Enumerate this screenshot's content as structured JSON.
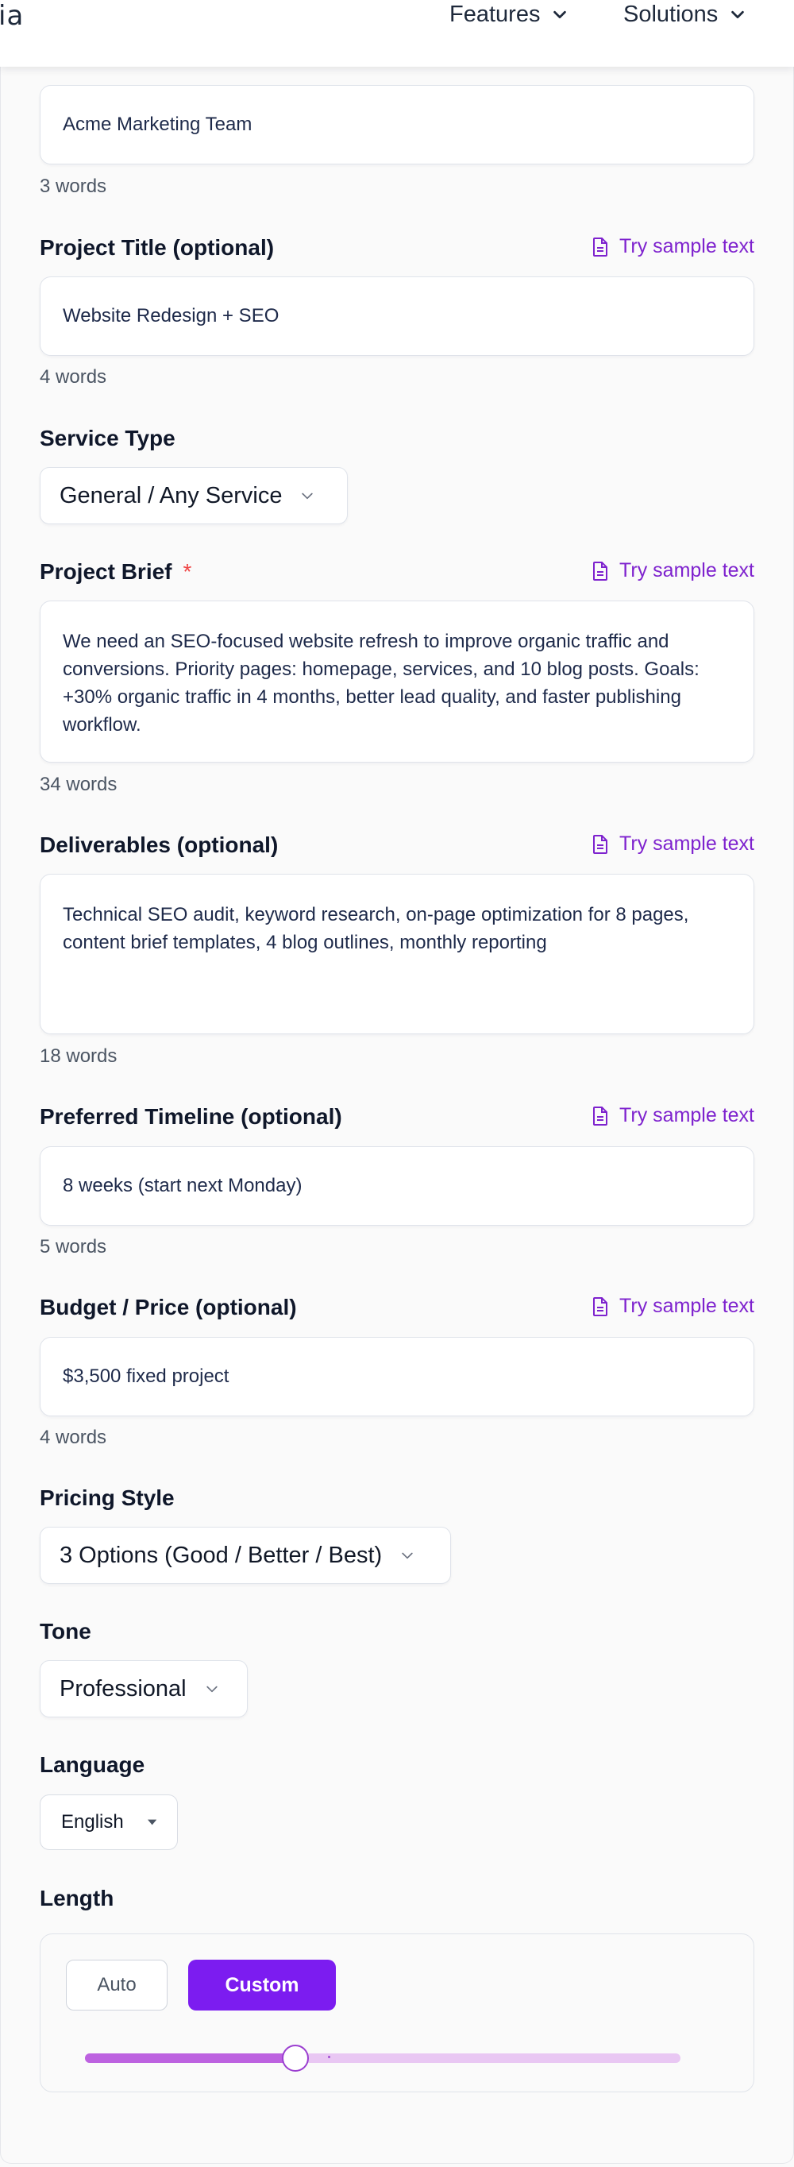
{
  "header": {
    "logo_fragment": "ia",
    "nav": [
      {
        "label": "Features"
      },
      {
        "label": "Solutions"
      }
    ]
  },
  "form": {
    "sample_link": "Try sample text",
    "client": {
      "value": "Acme Marketing Team",
      "count": "3 words"
    },
    "project_title": {
      "label": "Project Title (optional)",
      "value": "Website Redesign + SEO",
      "count": "4 words"
    },
    "service_type": {
      "label": "Service Type",
      "value": "General / Any Service"
    },
    "project_brief": {
      "label": "Project Brief",
      "required_mark": "*",
      "value": "We need an SEO-focused website refresh to improve organic traffic and conversions. Priority pages: homepage, services, and 10 blog posts. Goals: +30% organic traffic in 4 months, better lead quality, and faster publishing workflow.",
      "count": "34 words"
    },
    "deliverables": {
      "label": "Deliverables (optional)",
      "value": "Technical SEO audit, keyword research, on-page optimization for 8 pages, content brief templates, 4 blog outlines, monthly reporting",
      "count": "18 words"
    },
    "timeline": {
      "label": "Preferred Timeline (optional)",
      "value": "8 weeks (start next Monday)",
      "count": "5 words"
    },
    "budget": {
      "label": "Budget / Price (optional)",
      "value": "$3,500 fixed project",
      "count": "4 words"
    },
    "pricing_style": {
      "label": "Pricing Style",
      "value": "3 Options (Good / Better / Best)"
    },
    "tone": {
      "label": "Tone",
      "value": "Professional"
    },
    "language": {
      "label": "Language",
      "value": "English"
    },
    "length": {
      "label": "Length",
      "auto_label": "Auto",
      "custom_label": "Custom",
      "selected": "Custom",
      "slider_fraction": 0.353
    }
  },
  "colors": {
    "accent": "#7c1cf0",
    "link": "#7e22ce",
    "required": "#ef4444",
    "slider_track": "#e9c7f3",
    "slider_fill": "#bd62e0"
  },
  "icons": {
    "sample": "document-icon",
    "dropdown": "chevron-down-icon",
    "native_dropdown": "caret-down-icon"
  }
}
